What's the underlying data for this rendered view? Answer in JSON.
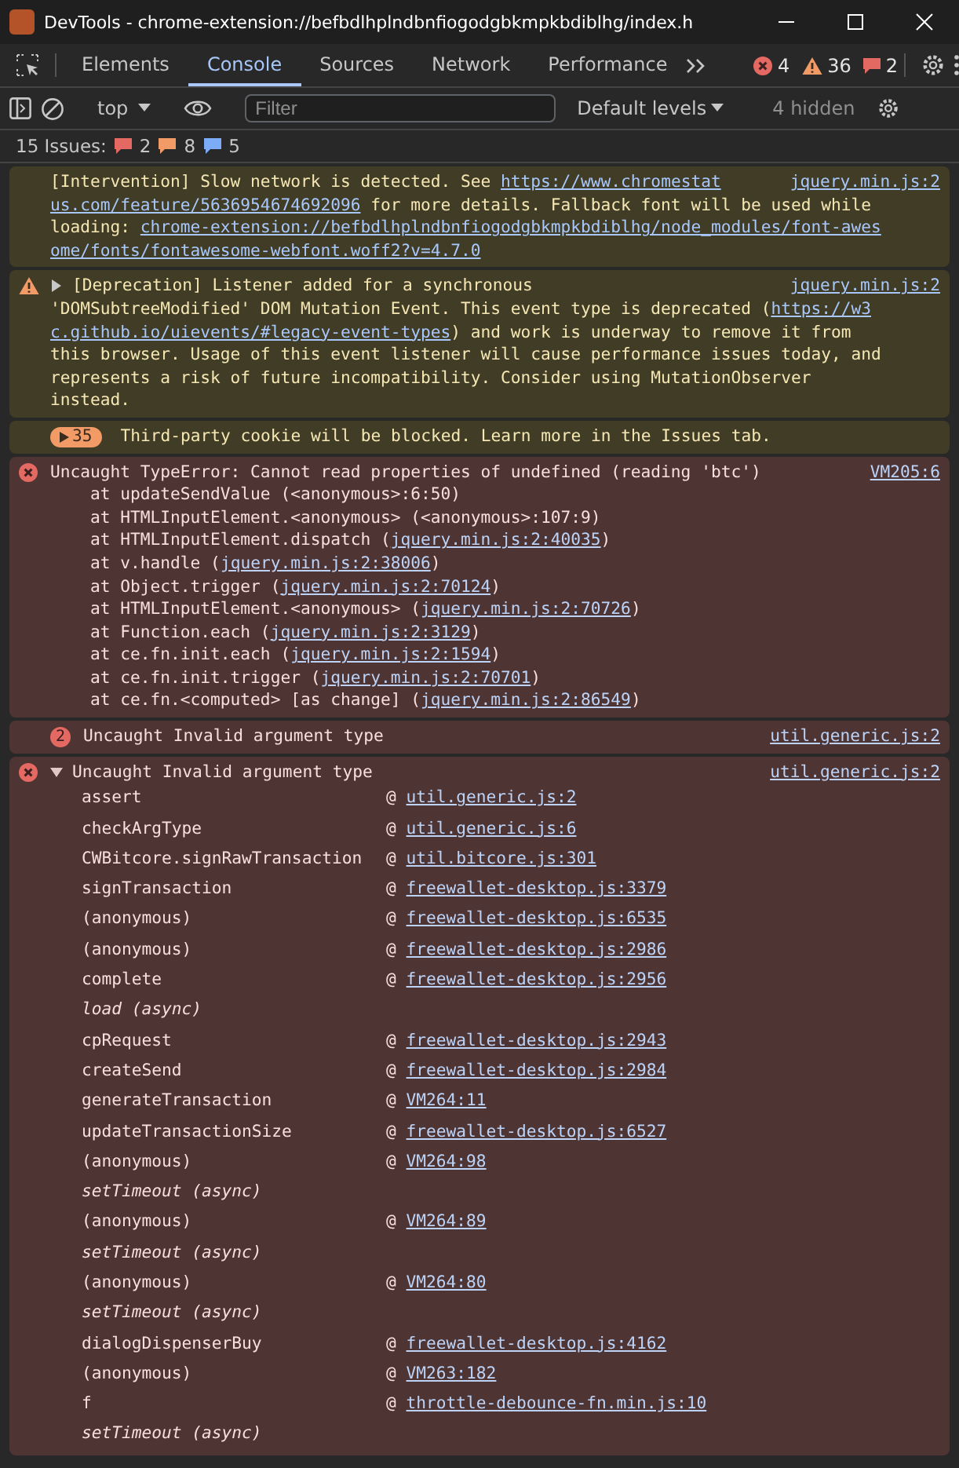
{
  "window": {
    "title": "DevTools - chrome-extension://befbdlhplndbnfiogodgbkmpkbdiblhg/index.h"
  },
  "tabs": [
    {
      "label": "Elements",
      "selected": false
    },
    {
      "label": "Console",
      "selected": true
    },
    {
      "label": "Sources",
      "selected": false
    },
    {
      "label": "Network",
      "selected": false
    },
    {
      "label": "Performance",
      "selected": false
    }
  ],
  "counters": {
    "errors": "4",
    "warnings": "36",
    "issues": "2"
  },
  "toolbar": {
    "context": "top",
    "filter": {
      "placeholder": "Filter"
    },
    "levels": "Default levels",
    "hidden": "4 hidden"
  },
  "issues_bar": {
    "label": "15 Issues:",
    "errors": "2",
    "warnings": "8",
    "info": "5"
  },
  "messages": [
    {
      "kind": "warning",
      "icon": false,
      "source": "jquery.min.js:2",
      "lines": [
        [
          {
            "kind": "text",
            "text": "[Intervention] Slow network is detected. See "
          },
          {
            "kind": "link",
            "text": "https://www.chromestat"
          }
        ],
        [
          {
            "kind": "link",
            "text": "us.com/feature/5636954674692096"
          },
          {
            "kind": "text",
            "text": " for more details. Fallback font will be used while"
          }
        ],
        [
          {
            "kind": "text",
            "text": "loading: "
          },
          {
            "kind": "link",
            "text": "chrome-extension://befbdlhplndbnfiogodgbkmpkbdiblhg/node_modules/font-awes"
          }
        ],
        [
          {
            "kind": "link",
            "text": "ome/fonts/fontawesome-webfont.woff2?v=4.7.0"
          }
        ]
      ]
    },
    {
      "kind": "warning",
      "icon": true,
      "expanded": false,
      "source": "jquery.min.js:2",
      "lines": [
        [
          {
            "kind": "text",
            "text": "[Deprecation] Listener added for a synchronous"
          }
        ],
        [
          {
            "kind": "text",
            "text": "'DOMSubtreeModified' DOM Mutation Event. This event type is deprecated ("
          },
          {
            "kind": "link",
            "text": "https://w3"
          }
        ],
        [
          {
            "kind": "link",
            "text": "c.github.io/uievents/#legacy-event-types"
          },
          {
            "kind": "text",
            "text": ") and work is underway to remove it from"
          }
        ],
        [
          {
            "kind": "text",
            "text": "this browser. Usage of this event listener will cause performance issues today, and"
          }
        ],
        [
          {
            "kind": "text",
            "text": "represents a risk of future incompatibility. Consider using MutationObserver"
          }
        ],
        [
          {
            "kind": "text",
            "text": "instead."
          }
        ]
      ]
    },
    {
      "kind": "warning",
      "icon": false,
      "count": "35",
      "lines": [
        [
          {
            "kind": "text",
            "text": "Third-party cookie will be blocked. Learn more in the Issues tab."
          }
        ]
      ]
    },
    {
      "kind": "error",
      "icon": true,
      "source": "VM205:6",
      "lines": [
        [
          {
            "kind": "text",
            "text": "Uncaught TypeError: Cannot read properties of undefined (reading 'btc')"
          }
        ],
        [
          {
            "kind": "text",
            "text": "    at updateSendValue (<anonymous>:6:50)"
          }
        ],
        [
          {
            "kind": "text",
            "text": "    at HTMLInputElement.<anonymous> (<anonymous>:107:9)"
          }
        ],
        [
          {
            "kind": "text",
            "text": "    at HTMLInputElement.dispatch ("
          },
          {
            "kind": "link",
            "text": "jquery.min.js:2:40035"
          },
          {
            "kind": "text",
            "text": ")"
          }
        ],
        [
          {
            "kind": "text",
            "text": "    at v.handle ("
          },
          {
            "kind": "link",
            "text": "jquery.min.js:2:38006"
          },
          {
            "kind": "text",
            "text": ")"
          }
        ],
        [
          {
            "kind": "text",
            "text": "    at Object.trigger ("
          },
          {
            "kind": "link",
            "text": "jquery.min.js:2:70124"
          },
          {
            "kind": "text",
            "text": ")"
          }
        ],
        [
          {
            "kind": "text",
            "text": "    at HTMLInputElement.<anonymous> ("
          },
          {
            "kind": "link",
            "text": "jquery.min.js:2:70726"
          },
          {
            "kind": "text",
            "text": ")"
          }
        ],
        [
          {
            "kind": "text",
            "text": "    at Function.each ("
          },
          {
            "kind": "link",
            "text": "jquery.min.js:2:3129"
          },
          {
            "kind": "text",
            "text": ")"
          }
        ],
        [
          {
            "kind": "text",
            "text": "    at ce.fn.init.each ("
          },
          {
            "kind": "link",
            "text": "jquery.min.js:2:1594"
          },
          {
            "kind": "text",
            "text": ")"
          }
        ],
        [
          {
            "kind": "text",
            "text": "    at ce.fn.init.trigger ("
          },
          {
            "kind": "link",
            "text": "jquery.min.js:2:70701"
          },
          {
            "kind": "text",
            "text": ")"
          }
        ],
        [
          {
            "kind": "text",
            "text": "    at ce.fn.<computed> [as change] ("
          },
          {
            "kind": "link",
            "text": "jquery.min.js:2:86549"
          },
          {
            "kind": "text",
            "text": ")"
          }
        ]
      ]
    },
    {
      "kind": "error",
      "icon": false,
      "count": "2",
      "source": "util.generic.js:2",
      "lines": [
        [
          {
            "kind": "text",
            "text": "Uncaught Invalid argument type"
          }
        ]
      ]
    },
    {
      "kind": "error",
      "icon": true,
      "expanded": true,
      "source": "util.generic.js:2",
      "lines": [
        [
          {
            "kind": "text",
            "text": "Uncaught Invalid argument type"
          }
        ]
      ],
      "frames": [
        {
          "kind": "call",
          "function": "assert",
          "at": "@",
          "location": "util.generic.js:2"
        },
        {
          "kind": "call",
          "function": "checkArgType",
          "at": "@",
          "location": "util.generic.js:6"
        },
        {
          "kind": "call",
          "function": "CWBitcore.signRawTransaction",
          "at": "@",
          "location": "util.bitcore.js:301"
        },
        {
          "kind": "call",
          "function": "signTransaction",
          "at": "@",
          "location": "freewallet-desktop.js:3379"
        },
        {
          "kind": "call",
          "function": "(anonymous)",
          "at": "@",
          "location": "freewallet-desktop.js:6535"
        },
        {
          "kind": "call",
          "function": "(anonymous)",
          "at": "@",
          "location": "freewallet-desktop.js:2986"
        },
        {
          "kind": "call",
          "function": "complete",
          "at": "@",
          "location": "freewallet-desktop.js:2956"
        },
        {
          "kind": "async",
          "function": "load (async)"
        },
        {
          "kind": "call",
          "function": "cpRequest",
          "at": "@",
          "location": "freewallet-desktop.js:2943"
        },
        {
          "kind": "call",
          "function": "createSend",
          "at": "@",
          "location": "freewallet-desktop.js:2984"
        },
        {
          "kind": "call",
          "function": "generateTransaction",
          "at": "@",
          "location": "VM264:11"
        },
        {
          "kind": "call",
          "function": "updateTransactionSize",
          "at": "@",
          "location": "freewallet-desktop.js:6527"
        },
        {
          "kind": "call",
          "function": "(anonymous)",
          "at": "@",
          "location": "VM264:98"
        },
        {
          "kind": "async",
          "function": "setTimeout (async)"
        },
        {
          "kind": "call",
          "function": "(anonymous)",
          "at": "@",
          "location": "VM264:89"
        },
        {
          "kind": "async",
          "function": "setTimeout (async)"
        },
        {
          "kind": "call",
          "function": "(anonymous)",
          "at": "@",
          "location": "VM264:80"
        },
        {
          "kind": "async",
          "function": "setTimeout (async)"
        },
        {
          "kind": "call",
          "function": "dialogDispenserBuy",
          "at": "@",
          "location": "freewallet-desktop.js:4162"
        },
        {
          "kind": "call",
          "function": "(anonymous)",
          "at": "@",
          "location": "VM263:182"
        },
        {
          "kind": "call",
          "function": "f",
          "at": "@",
          "location": "throttle-debounce-fn.min.js:10"
        },
        {
          "kind": "async",
          "function": "setTimeout (async)"
        }
      ]
    }
  ]
}
